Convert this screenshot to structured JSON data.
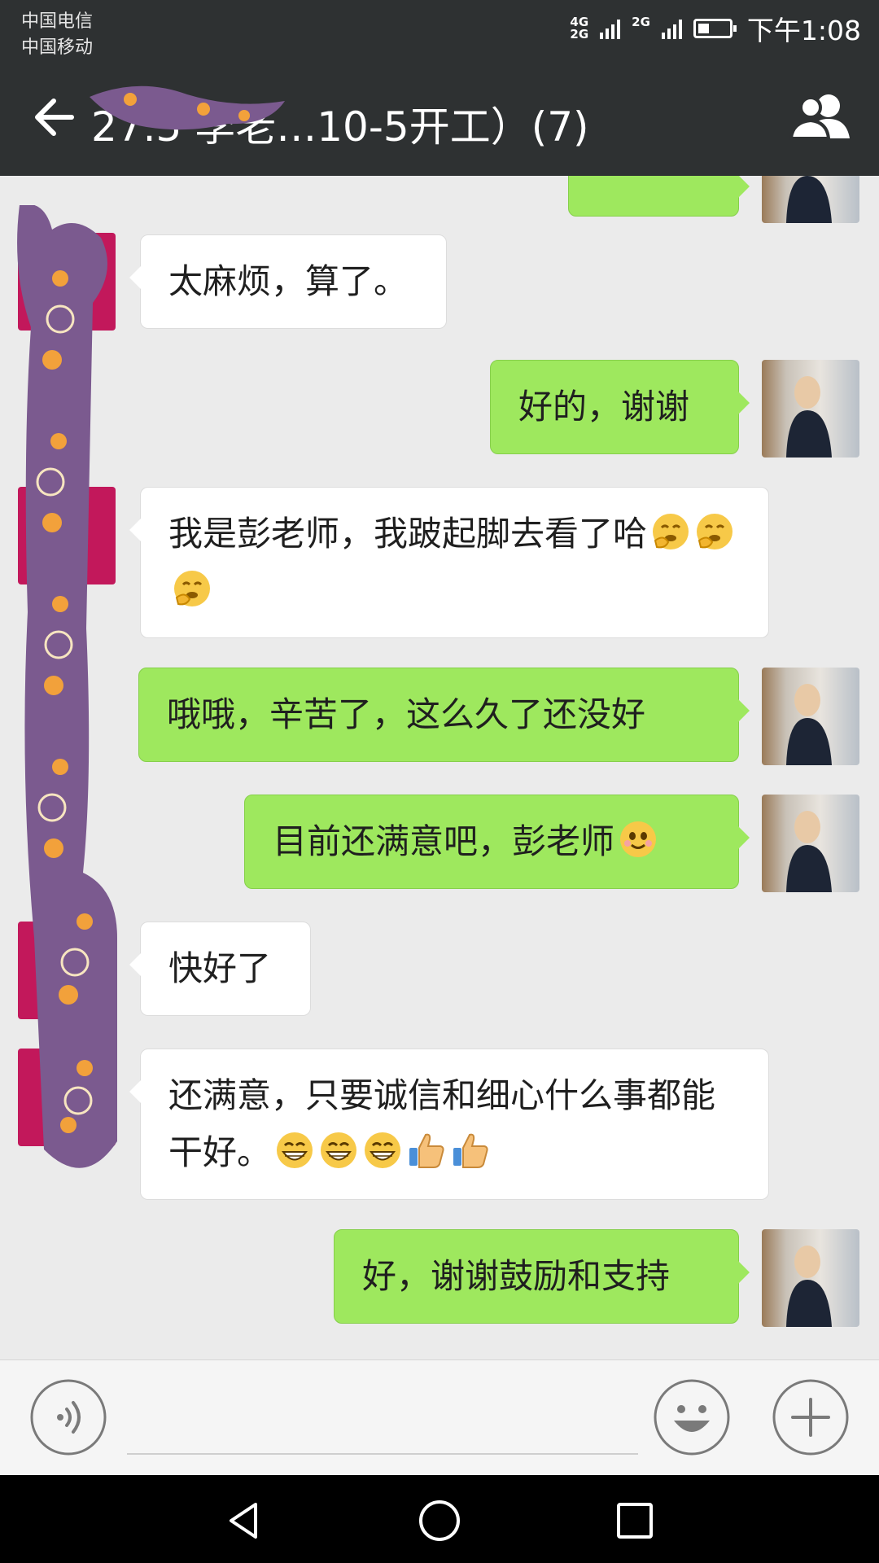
{
  "status_bar": {
    "carrier_1": "中国电信",
    "carrier_2": "中国移动",
    "net_1_top": "4G",
    "net_1_bottom": "2G",
    "net_2": "2G",
    "time": "下午1:08",
    "battery_level": 0.35
  },
  "header": {
    "title": "27.5  李老…10-5开工）(7)"
  },
  "messages": [
    {
      "side": "in",
      "text": "太麻烦，算了。",
      "emojis": []
    },
    {
      "side": "out",
      "text": "好的，谢谢",
      "emojis": []
    },
    {
      "side": "in",
      "text": "我是彭老师，我跛起脚去看了哈",
      "emojis": [
        "shy-laugh",
        "shy-laugh",
        "shy-laugh"
      ]
    },
    {
      "side": "out",
      "text": "哦哦，辛苦了，这么久了还没好",
      "emojis": []
    },
    {
      "side": "out",
      "text": "目前还满意吧，彭老师",
      "emojis": [
        "smile"
      ]
    },
    {
      "side": "in",
      "text": "快好了",
      "emojis": []
    },
    {
      "side": "in",
      "text": "还满意，只要诚信和细心什么事都能干好。",
      "emojis": [
        "grin",
        "grin",
        "grin",
        "thumbs-up",
        "thumbs-up"
      ]
    },
    {
      "side": "out",
      "text": "好，谢谢鼓励和支持",
      "emojis": []
    }
  ],
  "input": {
    "placeholder": ""
  },
  "icons": {
    "back": "back-arrow-icon",
    "group": "group-members-icon",
    "voice": "voice-icon",
    "emoji": "emoji-icon",
    "plus": "plus-icon",
    "nav_back": "nav-back-icon",
    "nav_home": "nav-home-icon",
    "nav_recent": "nav-recent-icon"
  },
  "colors": {
    "header_bg": "#2e3132",
    "chat_bg": "#ebebeb",
    "out_bubble": "#9ee85e",
    "in_bubble": "#ffffff",
    "redaction": "#7b5a8f"
  }
}
